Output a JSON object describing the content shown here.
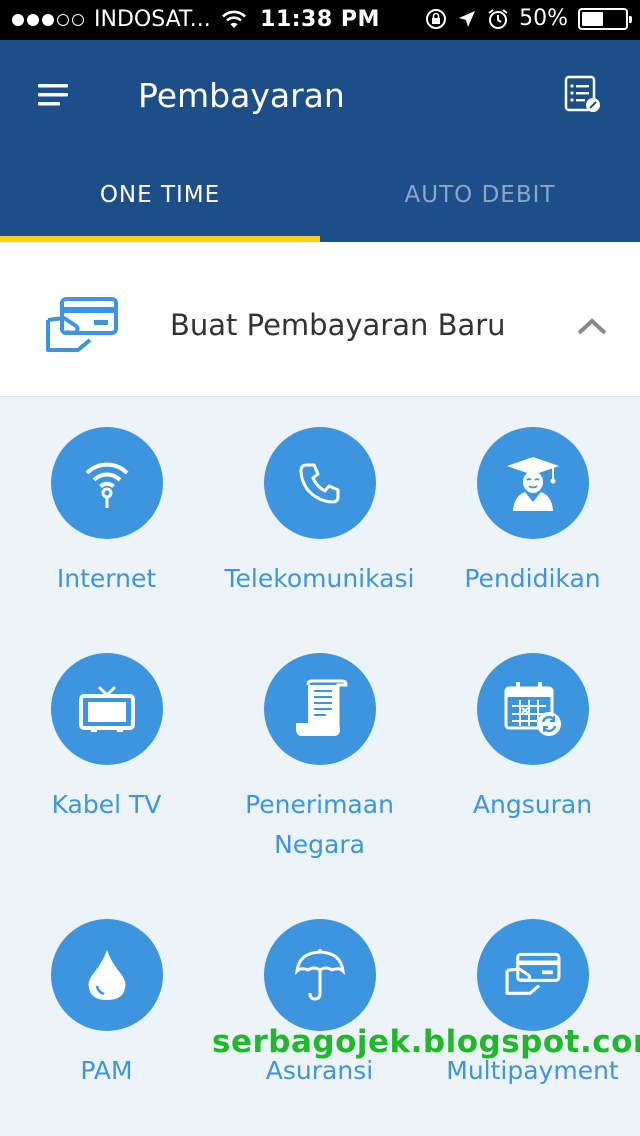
{
  "status_bar": {
    "carrier": "INDOSAT...",
    "time": "11:38 PM",
    "battery": "50%",
    "battery_level": 0.5
  },
  "header": {
    "title": "Pembayaran",
    "menu_icon": "hamburger-menu-icon",
    "history_icon": "receipt-list-icon"
  },
  "tabs": [
    {
      "label": "ONE TIME",
      "active": true
    },
    {
      "label": "AUTO DEBIT",
      "active": false
    }
  ],
  "section": {
    "title": "Buat Pembayaran Baru",
    "icon": "card-in-hand-icon",
    "expanded": true
  },
  "categories": [
    {
      "label": "Internet",
      "icon": "wifi-icon"
    },
    {
      "label": "Telekomunikasi",
      "icon": "phone-icon"
    },
    {
      "label": "Pendidikan",
      "icon": "graduate-icon"
    },
    {
      "label": "Kabel TV",
      "icon": "tv-icon"
    },
    {
      "label": "Penerimaan\nNegara",
      "icon": "scroll-icon"
    },
    {
      "label": "Angsuran",
      "icon": "calendar-icon"
    },
    {
      "label": "PAM",
      "icon": "water-drop-icon"
    },
    {
      "label": "Asuransi",
      "icon": "umbrella-icon"
    },
    {
      "label": "Multipayment",
      "icon": "card-in-hand-icon"
    }
  ],
  "watermark": "serbagojek.blogspot.com",
  "colors": {
    "primary": "#1c4f8a",
    "accent": "#f5d40b",
    "icon_circle": "#3d95df",
    "background": "#edf4f9"
  }
}
